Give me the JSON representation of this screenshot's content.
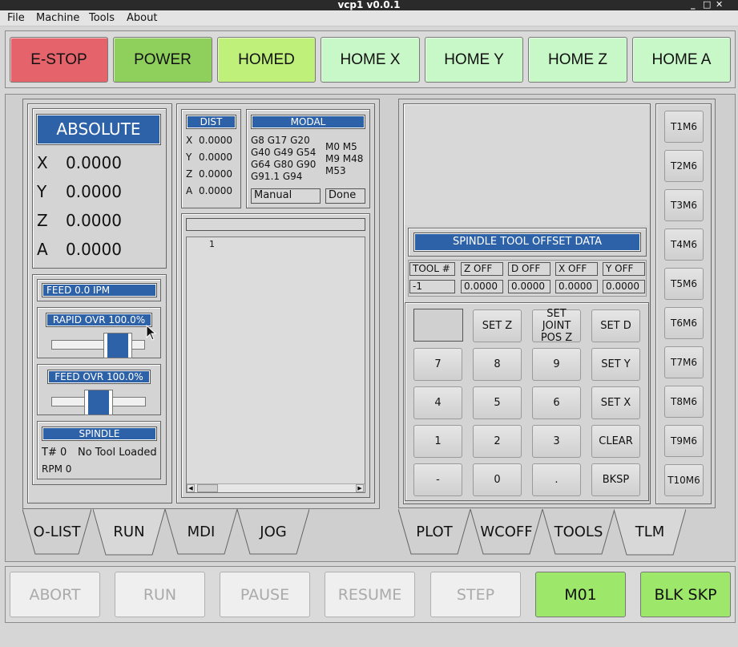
{
  "window": {
    "title": "vcp1 v0.0.1",
    "controls": [
      "_",
      "□",
      "✕"
    ]
  },
  "menu": [
    "File",
    "Machine",
    "Tools",
    "About"
  ],
  "top_buttons": {
    "estop": "E-STOP",
    "power": "POWER",
    "homed": "HOMED",
    "home_x": "HOME X",
    "home_y": "HOME Y",
    "home_z": "HOME Z",
    "home_a": "HOME A"
  },
  "dro": {
    "mode": "ABSOLUTE",
    "axes": [
      {
        "axis": "X",
        "value": "0.0000"
      },
      {
        "axis": "Y",
        "value": "0.0000"
      },
      {
        "axis": "Z",
        "value": "0.0000"
      },
      {
        "axis": "A",
        "value": "0.0000"
      }
    ]
  },
  "feed": {
    "label": "FEED 0.0  IPM"
  },
  "rapid_ovr": {
    "label": "RAPID OVR 100.0%",
    "level": 0.8
  },
  "feed_ovr": {
    "label": "FEED OVR 100.0%",
    "level": 0.5
  },
  "spindle": {
    "title": "SPINDLE",
    "tool_label": "T# 0",
    "tool_status": "No Tool Loaded",
    "rpm": "RPM 0"
  },
  "dist": {
    "title": "DIST",
    "rows": [
      {
        "axis": "X",
        "value": "0.0000"
      },
      {
        "axis": "Y",
        "value": "0.0000"
      },
      {
        "axis": "Z",
        "value": "0.0000"
      },
      {
        "axis": "A",
        "value": "0.0000"
      }
    ]
  },
  "modal": {
    "title": "MODAL",
    "gcodes": [
      "G8 G17 G20",
      "G40 G49 G54",
      "G64 G80 G90",
      "G91.1 G94"
    ],
    "mcodes": [
      "M0 M5",
      "M9 M48",
      "M53"
    ],
    "mode": "Manual",
    "state": "Done"
  },
  "editor": {
    "line_number": "1"
  },
  "offsets": {
    "title": "SPINDLE TOOL OFFSET DATA",
    "headers": [
      "TOOL #",
      "Z OFF",
      "D OFF",
      "X OFF",
      "Y OFF"
    ],
    "values": [
      "-1",
      "0.0000",
      "0.0000",
      "0.0000",
      "0.0000"
    ]
  },
  "keypad": {
    "set_z": "SET Z",
    "set_joint_1": "SET JOINT",
    "set_joint_2": "POS Z",
    "set_d": "SET D",
    "k7": "7",
    "k8": "8",
    "k9": "9",
    "set_y": "SET Y",
    "k4": "4",
    "k5": "5",
    "k6": "6",
    "set_x": "SET X",
    "k1": "1",
    "k2": "2",
    "k3": "3",
    "clear": "CLEAR",
    "minus": "-",
    "k0": "0",
    "dot": ".",
    "bksp": "BKSP"
  },
  "tool_buttons": [
    "T1M6",
    "T2M6",
    "T3M6",
    "T4M6",
    "T5M6",
    "T6M6",
    "T7M6",
    "T8M6",
    "T9M6",
    "T10M6"
  ],
  "left_tabs": [
    "O-LIST",
    "RUN",
    "MDI",
    "JOG"
  ],
  "right_tabs": [
    "PLOT",
    "WCOFF",
    "TOOLS",
    "TLM"
  ],
  "bottom": {
    "abort": "ABORT",
    "run": "RUN",
    "pause": "PAUSE",
    "resume": "RESUME",
    "step": "STEP",
    "m01": "M01",
    "blk_skp": "BLK SKP"
  },
  "colors": {
    "estop": "#e5636a",
    "power": "#8fd05c",
    "homed": "#bff07a",
    "home": "#c8f8c8",
    "label_blue": "#2e62a8",
    "m01": "#9de86a"
  }
}
